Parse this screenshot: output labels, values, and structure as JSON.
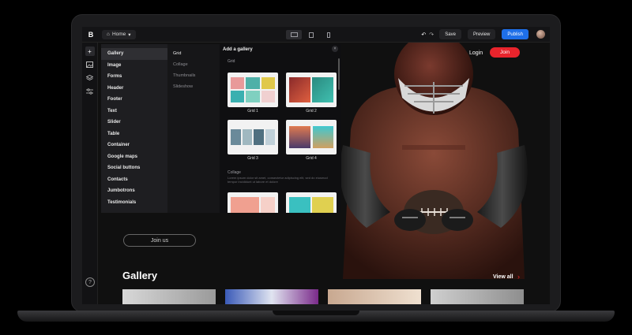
{
  "app": {
    "logo": "B",
    "page_select": "Home",
    "undo_symbol": "↶",
    "redo_symbol": "↷",
    "save_label": "Save",
    "preview_label": "Preview",
    "publish_label": "Publish"
  },
  "colors": {
    "accent": "#1e6fe8",
    "brand_red": "#e8242c"
  },
  "site": {
    "login_label": "Login",
    "join_label": "Join",
    "join_us_label": "Join us",
    "gallery_title": "Gallery",
    "view_all_label": "View all",
    "view_all_arrow": "›"
  },
  "panel": {
    "categories": [
      "Gallery",
      "Image",
      "Forms",
      "Header",
      "Footer",
      "Text",
      "Slider",
      "Table",
      "Container",
      "Google maps",
      "Social buttons",
      "Contacts",
      "Jumbotrons",
      "Testimonials"
    ],
    "subcategories": [
      "Grid",
      "Collage",
      "Thumbnails",
      "Slideshow"
    ],
    "title": "Add a gallery",
    "close_symbol": "×",
    "section_grid": "Grid",
    "section_collage": "Collage",
    "grid_labels": [
      "Grid 1",
      "Grid 2",
      "Grid 3",
      "Grid 4"
    ],
    "collage_desc": "Lorem ipsum dolor sit amet, consectetur adipiscing elit, sed do eiusmod tempor incididunt ut labore et dolore"
  },
  "rail": {
    "add_symbol": "+",
    "help_symbol": "?"
  }
}
